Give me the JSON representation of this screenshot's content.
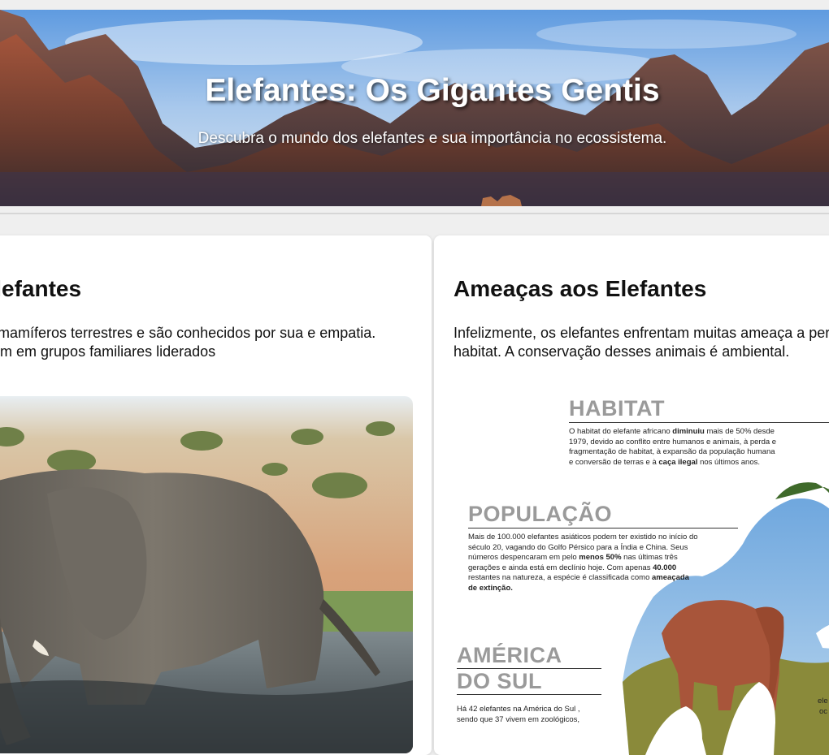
{
  "hero": {
    "title": "Elefantes: Os Gigantes Gentis",
    "subtitle": "Descubra o mundo dos elefantes e sua importância no ecossistema."
  },
  "cards": {
    "left": {
      "title": "dos Elefantes",
      "body": "maiores mamíferos terrestres e são conhecidos por sua e empatia. Eles vivem em grupos familiares liderados"
    },
    "right": {
      "title": "Ameaças aos Elefantes",
      "body": "Infelizmente, os elefantes enfrentam muitas ameaça a perda de habitat. A conservação desses animais é ambiental."
    }
  },
  "infographic": {
    "habitat": {
      "heading": "HABITAT",
      "p1": "O habitat do elefante africano ",
      "b1": "diminuiu",
      "p2": " mais de 50% desde 1979, devido ao conflito entre humanos e animais, à perda e fragmentação de habitat, à expansão da população humana e conversão de terras e à ",
      "b2": "caça ilegal",
      "p3": " nos últimos anos."
    },
    "populacao": {
      "heading": "POPULAÇÃO",
      "p1": "Mais de 100.000 elefantes asiáticos podem ter existido no início do século 20, vagando do Golfo Pérsico para a Índia e China. Seus números despencaram em pelo ",
      "b1": "menos 50%",
      "p2": " nas últimas três gerações e ainda está em declínio hoje. Com apenas ",
      "b2": "40.000",
      "p3": " restantes na natureza, a espécie é classificada como ",
      "b3": "ameaçada de extinção."
    },
    "america": {
      "heading_line1": "AMÉRICA",
      "heading_line2": "DO SUL",
      "text": "Há 42 elefantes na América do Sul , sendo que 37 vivem em zoológicos,"
    },
    "fragment1": "ele",
    "fragment2": "oc"
  },
  "colors": {
    "page_bg": "#efefef",
    "card_bg": "#ffffff",
    "heading_gray": "#9a9a9a",
    "text": "#111111"
  }
}
